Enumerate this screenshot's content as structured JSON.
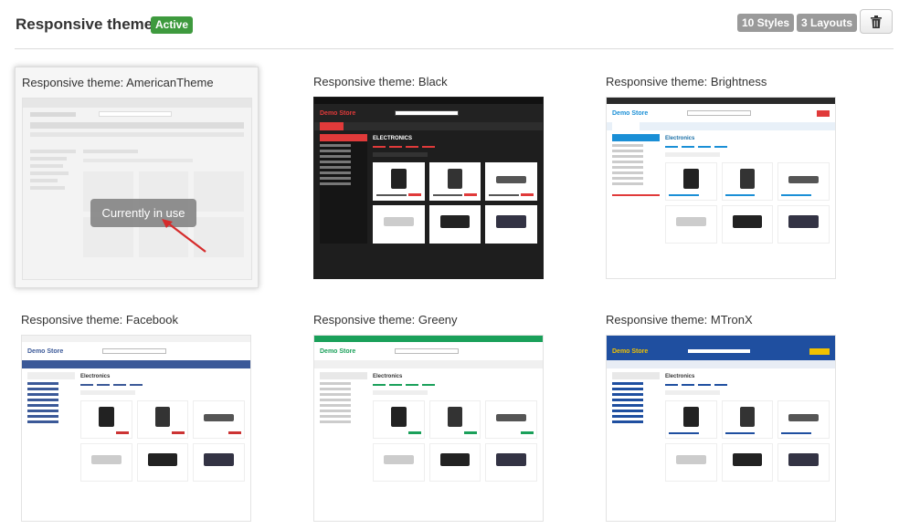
{
  "header": {
    "title": "Responsive theme",
    "status_badge": "Active",
    "styles_badge": "10 Styles",
    "layouts_badge": "3 Layouts",
    "delete_icon": "trash-icon"
  },
  "themes": [
    {
      "label": "Responsive theme: AmericanTheme",
      "current": true,
      "overlay": "Currently in use",
      "store_name": ""
    },
    {
      "label": "Responsive theme: Black",
      "current": false,
      "store_name": "Demo Store",
      "section": "ELECTRONICS"
    },
    {
      "label": "Responsive theme: Brightness",
      "current": false,
      "store_name": "Demo Store",
      "section": "Electronics"
    },
    {
      "label": "Responsive theme: Facebook",
      "current": false,
      "store_name": "Demo Store",
      "section": "Electronics"
    },
    {
      "label": "Responsive theme: Greeny",
      "current": false,
      "store_name": "Demo Store",
      "section": "Electronics"
    },
    {
      "label": "Responsive theme: MTronX",
      "current": false,
      "store_name": "Demo Store",
      "section": "Electronics"
    }
  ],
  "colors": {
    "active_badge": "#3e9a3e",
    "count_badge": "#9a9a9a",
    "black_theme_bg": "#1e1e1e",
    "black_theme_accent": "#e03a3a",
    "brightness_nav": "#e8f0f8",
    "facebook_bar": "#3b5998",
    "greeny_bar": "#1aa05a",
    "mtronx_bar": "#1f4fa0"
  }
}
